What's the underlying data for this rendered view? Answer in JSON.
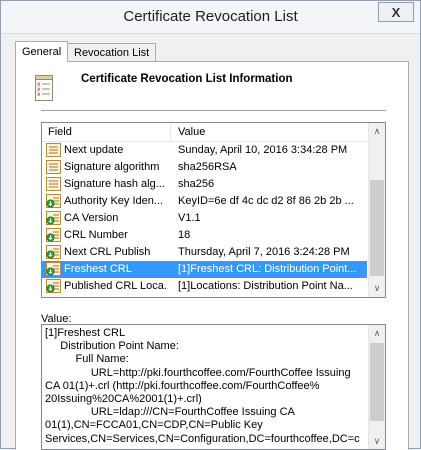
{
  "window": {
    "title": "Certificate Revocation List",
    "close_glyph": "X"
  },
  "tabs": [
    {
      "label": "General",
      "active": true
    },
    {
      "label": "Revocation List",
      "active": false
    }
  ],
  "header": {
    "title": "Certificate Revocation List Information",
    "icon": "crl-document-icon"
  },
  "fields_list": {
    "columns": [
      "Field",
      "Value"
    ],
    "rows": [
      {
        "field": "Next update",
        "value": "Sunday, April 10, 2016 3:34:28 PM",
        "icon": "property-doc-icon"
      },
      {
        "field": "Signature algorithm",
        "value": "sha256RSA",
        "icon": "property-doc-icon"
      },
      {
        "field": "Signature hash alg...",
        "value": "sha256",
        "icon": "property-doc-icon"
      },
      {
        "field": "Authority Key Iden...",
        "value": "KeyID=6e df 4c dc d2 8f 86 2b 2b ...",
        "icon": "extension-doc-icon"
      },
      {
        "field": "CA Version",
        "value": "V1.1",
        "icon": "extension-doc-icon"
      },
      {
        "field": "CRL Number",
        "value": "18",
        "icon": "extension-doc-icon"
      },
      {
        "field": "Next CRL Publish",
        "value": "Thursday, April 7, 2016 3:24:28 PM",
        "icon": "extension-doc-icon"
      },
      {
        "field": "Freshest CRL",
        "value": "[1]Freshest CRL: Distribution Point...",
        "icon": "extension-doc-icon",
        "selected": true
      },
      {
        "field": "Published CRL Loca...",
        "value": "[1]Locations: Distribution Point Na...",
        "icon": "extension-doc-icon"
      }
    ]
  },
  "value_section": {
    "label": "Value:",
    "lines": [
      "[1]Freshest CRL",
      "     Distribution Point Name:",
      "          Full Name:",
      "               URL=http://pki.fourthcoffee.com/FourthCoffee Issuing",
      "CA 01(1)+.crl (http://pki.fourthcoffee.com/FourthCoffee%",
      "20Issuing%20CA%2001(1)+.crl)",
      "               URL=ldap:///CN=FourthCoffee Issuing CA",
      "01(1),CN=FCCA01,CN=CDP,CN=Public Key",
      "Services,CN=Services,CN=Configuration,DC=fourthcoffee,DC=c"
    ]
  },
  "scroll_glyphs": {
    "up": "∧",
    "down": "∨"
  },
  "colors": {
    "selection": "#3399ff",
    "title_bar": "#f3f5f8"
  }
}
